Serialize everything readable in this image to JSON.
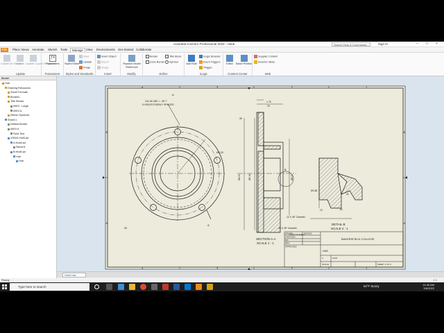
{
  "app": {
    "title": "Autodesk Inventor Professional 2020 - Hub6",
    "search_placeholder": "Search Help & Commands...",
    "sign_in": "Sign In"
  },
  "menu": {
    "file": "File",
    "tabs": [
      "Place Views",
      "Annotate",
      "Sketch",
      "Tools",
      "Manage",
      "View",
      "Environments",
      "Get Started",
      "Collaborate"
    ]
  },
  "ribbon": {
    "update": {
      "label": "Update",
      "items": [
        "Update All Sheets",
        "Update",
        "Update Copied Properties"
      ]
    },
    "parameters": {
      "label": "Parameters",
      "items": [
        "Parameters"
      ]
    },
    "styles": {
      "label": "Styles and Standards",
      "items": [
        "Styles Editor",
        "Save",
        "Update",
        "Purge"
      ]
    },
    "insert": {
      "label": "Insert",
      "items": [
        "Insert Object",
        "Import",
        "Image"
      ]
    },
    "modify": {
      "label": "Modify",
      "items": [
        "Replace Model Reference"
      ]
    },
    "define": {
      "label": "Define",
      "items": [
        "Border",
        "Title Block",
        "Zone Border",
        "Symbol"
      ]
    },
    "ilogic": {
      "label": "iLogic",
      "items": [
        "Add Rule",
        "iLogic Browser",
        "Event Triggers",
        "iTrigger"
      ]
    },
    "content": {
      "label": "Content Center",
      "items": [
        "Editor",
        "Batch Publish"
      ]
    },
    "web": {
      "label": "Web",
      "items": [
        "Supplier Content",
        "Inventor Ideas"
      ]
    }
  },
  "browser": {
    "header": "Model",
    "nodes": [
      "Hub",
      "Drawing Resources",
      "Sheet Formats",
      "Borders",
      "Title Blocks",
      "ANSI - Large",
      "ANSI A",
      "Sketch Symbols",
      "Sheet:1",
      "Default Border",
      "ANSI A",
      "Field Text",
      "VIEW1:HUB.ipt",
      "A:Hub6.ipt",
      "Sketch1",
      "B:Hub6.ipt",
      "Hub",
      "Hub"
    ]
  },
  "drawing": {
    "section_label": "SECTION  A-A",
    "section_scale": "SCALE  1 : 1",
    "detail_label": "DETAIL  B",
    "detail_scale": "SCALE  2 : 1",
    "hole_note_1": "1/4-18 UNC = .45 ▽",
    "hole_note_2": "5 HOLES EVENLY SPACED",
    "chamfer_1": ".12 X 45° Chamfer",
    "chamfer_2": ".06 X 45° Chamfer",
    "dims": [
      "1.75",
      ".75",
      ".35",
      "Ø4.25",
      "Ø2.50",
      "Ø2.18",
      "Ø3.20",
      "Ø1.88",
      "Ø1.84",
      ".40",
      ".13",
      ".50",
      ".25"
    ],
    "view_letters": [
      "A",
      "A",
      "B"
    ],
    "zone_numbers": [
      "4",
      "3",
      "2",
      "1"
    ],
    "zone_letters": [
      "B",
      "A"
    ]
  },
  "titleblock": {
    "school": "BAKERSFIELD COLLEGE",
    "rows": [
      [
        "DRAWN",
        "YOUR STUDENT"
      ],
      [
        "CHECKED",
        ""
      ],
      [
        "QA",
        ""
      ],
      [
        "MFG",
        ""
      ],
      [
        "APPROVED",
        ""
      ]
    ],
    "date": "3/6/2022",
    "part": "HUB",
    "size": "A",
    "dwg": "Hub6",
    "scale": "SCALE",
    "sheet": "SHEET 1 OF 1"
  },
  "doc_tab": "Hub6.idw",
  "status": {
    "text": "Ready",
    "numbers": "1     1"
  },
  "taskbar": {
    "search": "Type here to search",
    "weather": "64°F  Sunny",
    "time": "11:46 AM",
    "date": "3/6/2022"
  },
  "colors": {
    "accent": "#e8891d",
    "sheet": "#ecebdc",
    "canvas": "#d9e4ef",
    "line": "#1a1a1a"
  }
}
